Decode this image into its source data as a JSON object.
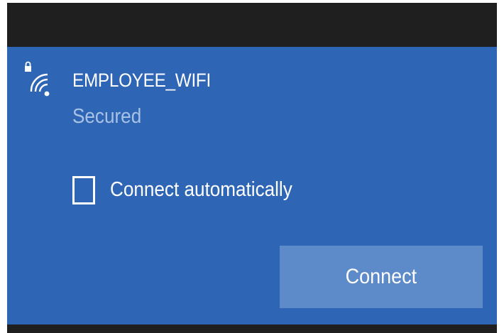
{
  "network": {
    "ssid": "EMPLOYEE_WIFI",
    "status": "Secured",
    "icon": "wifi-secured-icon"
  },
  "options": {
    "auto_connect_label": "Connect automatically",
    "auto_connect_checked": false
  },
  "actions": {
    "connect_label": "Connect"
  },
  "colors": {
    "panel": "#2e65b4",
    "button": "#5d8ac8",
    "bar": "#1f1f1f",
    "status_text": "#a8c2e6"
  }
}
